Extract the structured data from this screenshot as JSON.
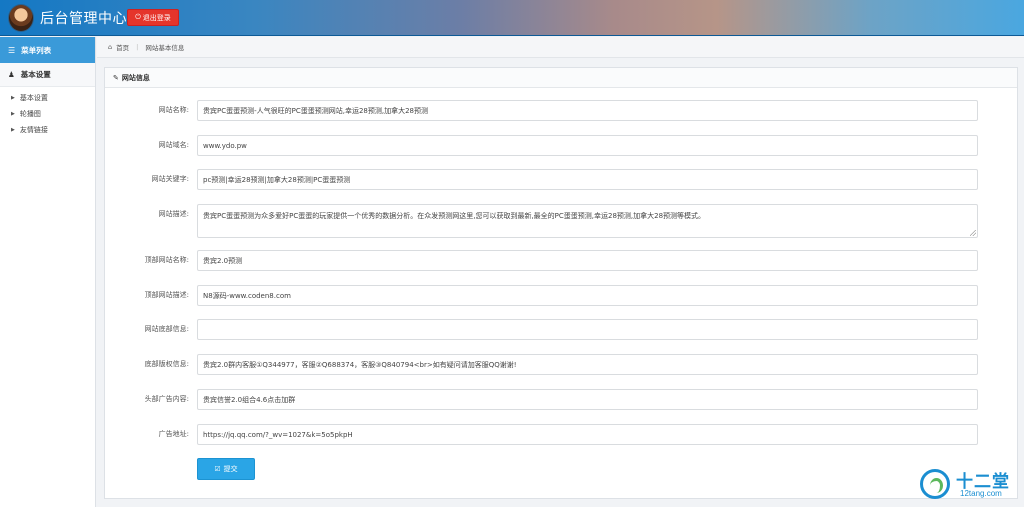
{
  "header": {
    "title": "后台管理中心",
    "logout_label": "退出登录"
  },
  "sidebar": {
    "menu_title": "菜单列表",
    "group_title": "基本设置",
    "items": [
      "基本设置",
      "轮播图",
      "友情链接"
    ]
  },
  "breadcrumb": {
    "home": "首页",
    "current": "网站基本信息"
  },
  "panel": {
    "title": "网站信息"
  },
  "form": {
    "fields": [
      {
        "label": "网站名称:",
        "value": "贵宾PC蛋蛋预测-人气很旺的PC蛋蛋预测网站,幸运28预测,加拿大28预测"
      },
      {
        "label": "网站域名:",
        "value": "www.ydo.pw"
      },
      {
        "label": "网站关键字:",
        "value": "pc预测|幸运28预测|加拿大28预测|PC蛋蛋预测"
      },
      {
        "label": "网站描述:",
        "value": "贵宾PC蛋蛋预测为众多爱好PC蛋蛋的玩家提供一个优秀的数据分析。在众发预测网这里,您可以获取到最新,最全的PC蛋蛋预测,幸运28预测,加拿大28预测等模式。"
      },
      {
        "label": "顶部网站名称:",
        "value": "贵宾2.0预测"
      },
      {
        "label": "顶部网站描述:",
        "value": "N8源码-www.coden8.com"
      },
      {
        "label": "网站底部信息:",
        "value": ""
      },
      {
        "label": "底部版权信息:",
        "value": "贵宾2.0群内客服①Q344977，客服②Q688374，客服③Q840794<br>如有疑问请加客服QQ谢谢!"
      },
      {
        "label": "头部广告内容:",
        "value": "贵宾信誉2.0组合4.6点击加群"
      },
      {
        "label": "广告地址:",
        "value": "https://jq.qq.com/?_wv=1027&k=5o5pkpH"
      }
    ],
    "submit_label": "提交"
  },
  "watermark": {
    "big": "十二堂",
    "small": "12tang.com"
  },
  "colors": {
    "header_blue": "#1478c4",
    "menu_blue": "#3a9ad9",
    "logout_red": "#e5352b",
    "submit_blue": "#2aa5e6"
  },
  "icons": {
    "logout": "power-icon",
    "menu": "list-icon",
    "group": "user-icon",
    "home": "home-icon",
    "panel": "edit-icon",
    "submit": "check-icon"
  }
}
